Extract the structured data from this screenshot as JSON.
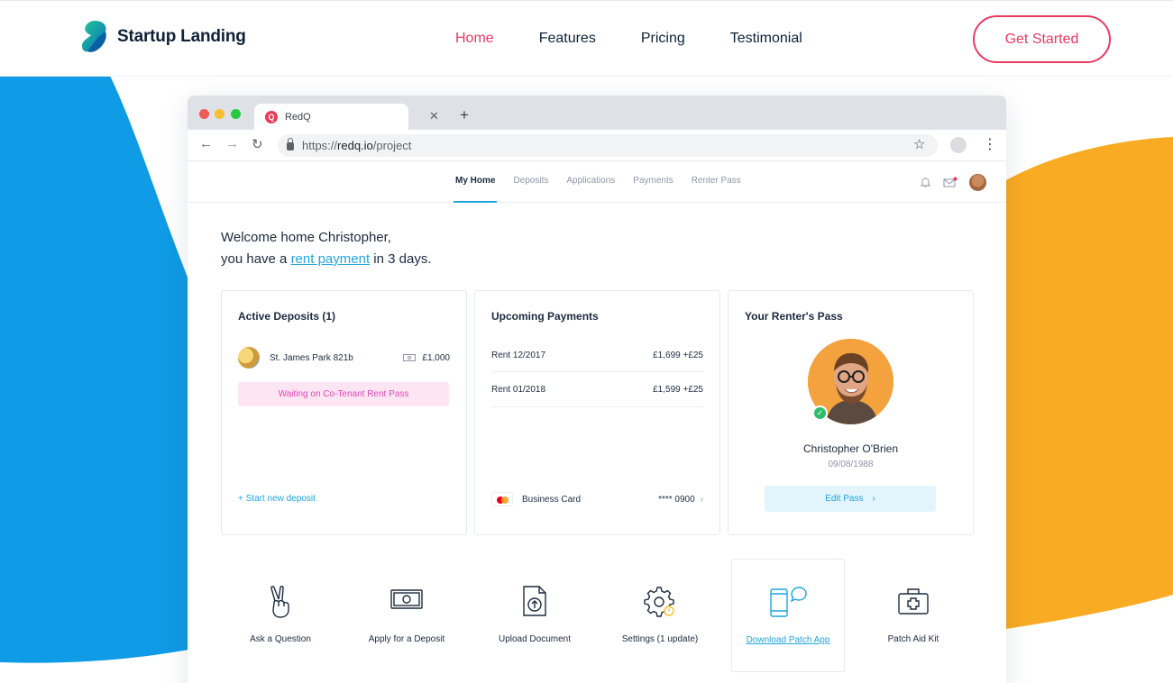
{
  "header": {
    "brand": "Startup Landing",
    "nav": [
      "Home",
      "Features",
      "Pricing",
      "Testimonial"
    ],
    "active_nav": "Home",
    "cta": "Get Started"
  },
  "colors": {
    "accent": "#ea3a60",
    "blue_blob": "#0f9be5",
    "orange_blob": "#f9a825",
    "app_link": "#20a4dd"
  },
  "browser": {
    "tab_title": "RedQ",
    "favicon_letter": "Q",
    "url_scheme": "https://",
    "url_host": "redq.io",
    "url_path": "/project"
  },
  "app": {
    "nav": [
      "My Home",
      "Deposits",
      "Applications",
      "Payments",
      "Renter Pass"
    ],
    "welcome_line1": "Welcome home Christopher,",
    "welcome_pre": "you have a",
    "welcome_link": "rent payment",
    "welcome_post": "in 3 days.",
    "deposits": {
      "title": "Active Deposits (1)",
      "property": "St. James Park 821b",
      "amount": "£1,000",
      "status": "Waiting on Co-Tenant Rent Pass",
      "action": "+ Start new deposit"
    },
    "payments": {
      "title": "Upcoming Payments",
      "rows": [
        {
          "label": "Rent 12/2017",
          "amount": "£1,699 +£25"
        },
        {
          "label": "Rent 01/2018",
          "amount": "£1,599 +£25"
        }
      ],
      "card_name": "Business Card",
      "card_number": "**** 0900"
    },
    "pass": {
      "title": "Your Renter's Pass",
      "name": "Christopher O'Brien",
      "dob": "09/08/1988",
      "button": "Edit Pass"
    },
    "actions": [
      {
        "label": "Ask a Question",
        "icon": "peace-hand-icon"
      },
      {
        "label": "Apply for a Deposit",
        "icon": "banknote-icon"
      },
      {
        "label": "Upload Document",
        "icon": "upload-document-icon"
      },
      {
        "label": "Settings (1 update)",
        "icon": "settings-gear-icon"
      },
      {
        "label": "Download Patch App",
        "icon": "phone-chat-icon"
      },
      {
        "label": "Patch Aid Kit",
        "icon": "first-aid-kit-icon"
      }
    ]
  }
}
